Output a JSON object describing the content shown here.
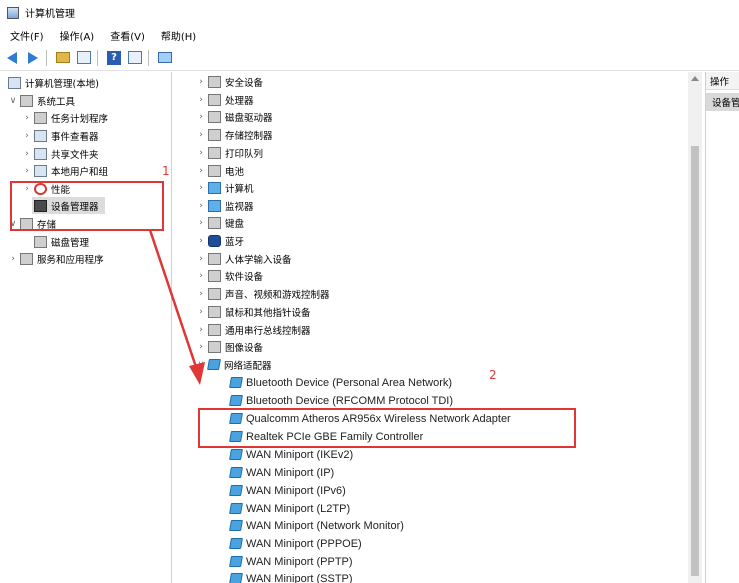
{
  "window": {
    "title": "计算机管理"
  },
  "menu": [
    "文件(F)",
    "操作(A)",
    "查看(V)",
    "帮助(H)"
  ],
  "toolbar": {
    "icons": [
      "back-arrow-icon",
      "forward-arrow-icon",
      "folder-up-icon",
      "properties-icon",
      "help-icon",
      "show-hide-tree-icon",
      "computer-icon"
    ],
    "help_glyph": "?"
  },
  "left_tree": [
    {
      "label": "计算机管理(本地)",
      "chev": "",
      "icon": "computer-management-icon"
    },
    {
      "label": "系统工具",
      "chev": "∨",
      "icon": "system-tools-icon"
    },
    {
      "label": "任务计划程序",
      "chev": "›",
      "icon": "task-scheduler-icon"
    },
    {
      "label": "事件查看器",
      "chev": "›",
      "icon": "event-viewer-icon"
    },
    {
      "label": "共享文件夹",
      "chev": "›",
      "icon": "shared-folders-icon"
    },
    {
      "label": "本地用户和组",
      "chev": "›",
      "icon": "local-users-icon"
    },
    {
      "label": "性能",
      "chev": "›",
      "icon": "performance-icon"
    },
    {
      "label": "设备管理器",
      "chev": "",
      "icon": "device-manager-icon"
    },
    {
      "label": "存储",
      "chev": "∨",
      "icon": "storage-icon"
    },
    {
      "label": "磁盘管理",
      "chev": "",
      "icon": "disk-management-icon"
    },
    {
      "label": "服务和应用程序",
      "chev": "›",
      "icon": "services-apps-icon"
    }
  ],
  "device_tree": [
    {
      "label": "安全设备",
      "chev": "›",
      "icon": "security-device-icon"
    },
    {
      "label": "处理器",
      "chev": "›",
      "icon": "processor-icon"
    },
    {
      "label": "磁盘驱动器",
      "chev": "›",
      "icon": "disk-drive-icon"
    },
    {
      "label": "存储控制器",
      "chev": "›",
      "icon": "storage-controller-icon"
    },
    {
      "label": "打印队列",
      "chev": "›",
      "icon": "print-queue-icon"
    },
    {
      "label": "电池",
      "chev": "›",
      "icon": "battery-icon"
    },
    {
      "label": "计算机",
      "chev": "›",
      "icon": "computer-icon"
    },
    {
      "label": "监视器",
      "chev": "›",
      "icon": "monitor-icon"
    },
    {
      "label": "键盘",
      "chev": "›",
      "icon": "keyboard-icon"
    },
    {
      "label": "蓝牙",
      "chev": "›",
      "icon": "bluetooth-icon"
    },
    {
      "label": "人体学输入设备",
      "chev": "›",
      "icon": "hid-icon"
    },
    {
      "label": "软件设备",
      "chev": "›",
      "icon": "software-device-icon"
    },
    {
      "label": "声音、视频和游戏控制器",
      "chev": "›",
      "icon": "sound-icon"
    },
    {
      "label": "鼠标和其他指针设备",
      "chev": "›",
      "icon": "mouse-icon"
    },
    {
      "label": "通用串行总线控制器",
      "chev": "›",
      "icon": "usb-icon"
    },
    {
      "label": "图像设备",
      "chev": "›",
      "icon": "imaging-device-icon"
    },
    {
      "label": "网络适配器",
      "chev": "∨",
      "icon": "network-adapter-icon"
    }
  ],
  "network_adapters": [
    "Bluetooth Device (Personal Area Network)",
    "Bluetooth Device (RFCOMM Protocol TDI)",
    "Qualcomm Atheros AR956x Wireless Network Adapter",
    "Realtek PCIe GBE Family Controller",
    "WAN Miniport (IKEv2)",
    "WAN Miniport (IP)",
    "WAN Miniport (IPv6)",
    "WAN Miniport (L2TP)",
    "WAN Miniport (Network Monitor)",
    "WAN Miniport (PPPOE)",
    "WAN Miniport (PPTP)",
    "WAN Miniport (SSTP)"
  ],
  "actions_pane": {
    "header": "操作",
    "item": "设备管理器"
  },
  "annotations": {
    "one": "1",
    "two": "2"
  },
  "colors": {
    "annotation_red": "#e03636",
    "accent_blue": "#2f7bd1"
  }
}
